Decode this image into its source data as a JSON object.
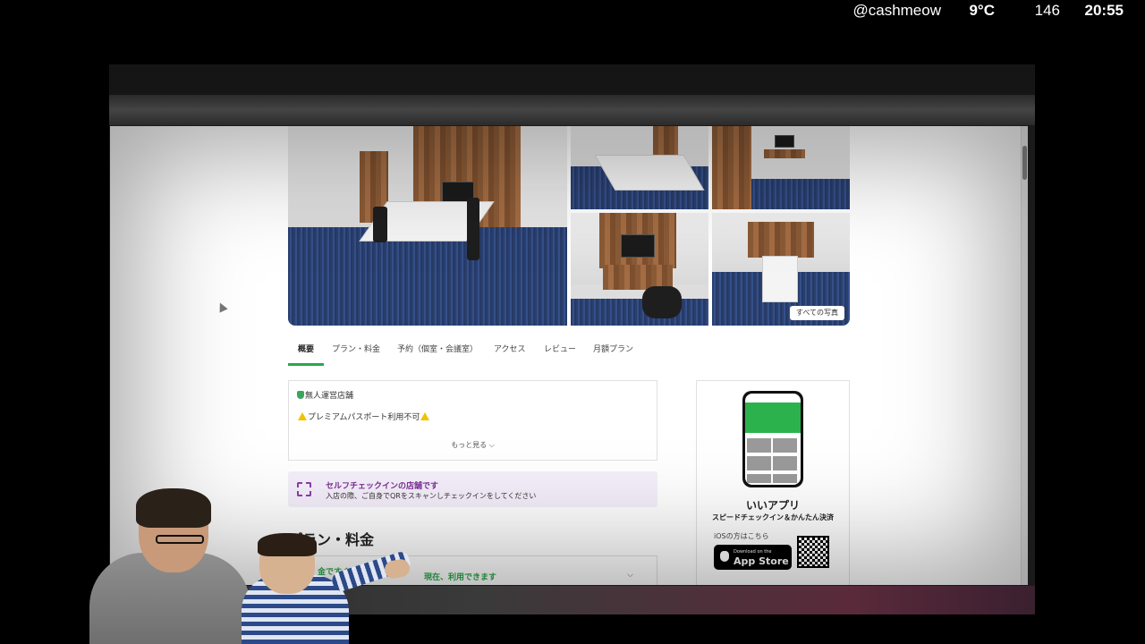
{
  "overlay": {
    "username": "@cashmeow",
    "temperature": "9°C",
    "count": "146",
    "time": "20:55"
  },
  "gallery": {
    "all_photos_label": "すべての写真"
  },
  "tabs": [
    {
      "label": "概要",
      "active": true
    },
    {
      "label": "プラン・料金",
      "active": false
    },
    {
      "label": "予約（個室・会議室）",
      "active": false
    },
    {
      "label": "アクセス",
      "active": false
    },
    {
      "label": "レビュー",
      "active": false
    },
    {
      "label": "月額プラン",
      "active": false
    }
  ],
  "info": {
    "unmanned": "無人運営店舗",
    "premium_warning": "プレミアムパスポート利用不可",
    "more_label": "もっと見る"
  },
  "checkin": {
    "title": "セルフチェックインの店舗です",
    "subtitle": "入店の際、ご自身でQRをスキャンしチェックインをしてください"
  },
  "plans": {
    "heading": "プラン・料金",
    "badge_partial": "金ですぐ",
    "status": "現在、利用できます"
  },
  "app_promo": {
    "app_name": "いいアプリ",
    "tagline": "スピードチェックイン＆かんたん決済",
    "ios_label": "iOSの方はこちら",
    "store_small": "Download on the",
    "store_big": "App Store"
  },
  "colors": {
    "accent_green": "#2aa84a",
    "checkin_purple": "#7b2d93",
    "checkin_bg": "#f4effa"
  }
}
